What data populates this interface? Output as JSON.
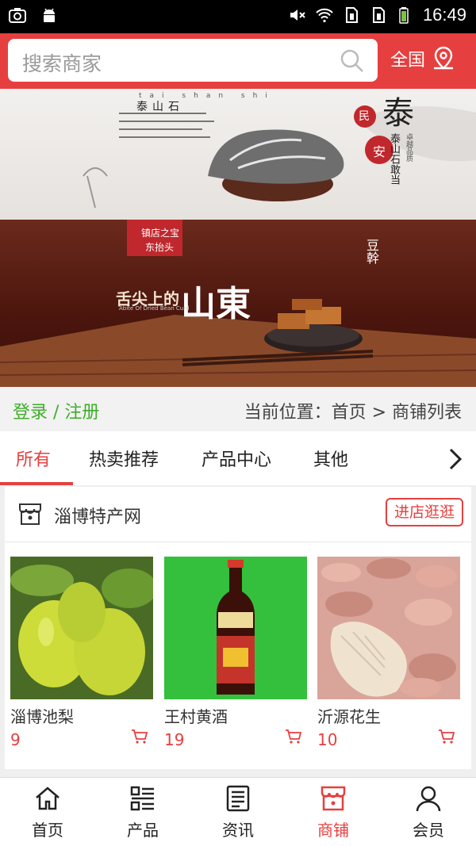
{
  "status": {
    "time": "16:49"
  },
  "header": {
    "search_placeholder": "搜索商家",
    "region": "全国"
  },
  "banner1": {
    "pinyin": [
      "tai",
      "shan",
      "shi"
    ],
    "title": "泰山石",
    "stamp1": "民",
    "stamp2": "安",
    "big": "泰",
    "side1": "泰山石敢当",
    "side2": "卓越品质"
  },
  "banner2": {
    "badge1": "镇店之宝",
    "badge2": "东抬头",
    "slogan": "舌尖上的",
    "region": "山東",
    "sub": "Abite Of Dried Bean Curd",
    "product": "豆幹"
  },
  "nav_bar": {
    "login": "登录 / 注册",
    "location": "当前位置：首页 > 商铺列表"
  },
  "tabs": [
    "所有",
    "热卖推荐",
    "产品中心",
    "其他"
  ],
  "shop": {
    "name": "淄博特产网",
    "enter_label": "进店逛逛",
    "products": [
      {
        "name": "淄博池梨",
        "price": "9"
      },
      {
        "name": "王村黄酒",
        "price": "19"
      },
      {
        "name": "沂源花生",
        "price": "10"
      }
    ]
  },
  "bottom_nav": [
    "首页",
    "产品",
    "资讯",
    "商铺",
    "会员"
  ],
  "colors": {
    "accent": "#e63f3f",
    "login": "#3fae2a"
  }
}
